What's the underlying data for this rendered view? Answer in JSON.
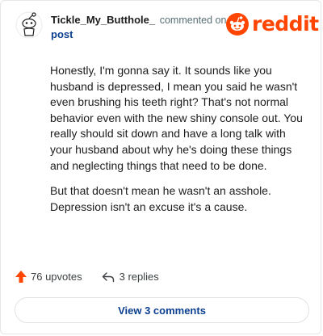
{
  "comment": {
    "author": "Tickle_My_Butthole_",
    "action_text": "commented on",
    "post_link": "post",
    "paragraphs": [
      "Honestly, I'm gonna say it. It sounds like you husband is depressed, I mean you said he wasn't even brushing his teeth right? That's not normal behavior even with the new shiny console out. You really should sit down and have a long talk with your husband about why he's doing these things and neglecting things that need to be done.",
      "But that doesn't mean he wasn't an asshole. Depression isn't an excuse it's a cause."
    ]
  },
  "brand": {
    "logo_text": "reddit",
    "color": "#ff4500"
  },
  "actions": {
    "upvotes": "76 upvotes",
    "replies": "3 replies"
  },
  "footer": {
    "view_comments": "View 3 comments"
  },
  "icons": {
    "avatar": "snoo-avatar-icon",
    "logo": "reddit-snoo-icon",
    "upvote": "upvote-arrow-icon",
    "reply": "reply-arrow-icon"
  }
}
